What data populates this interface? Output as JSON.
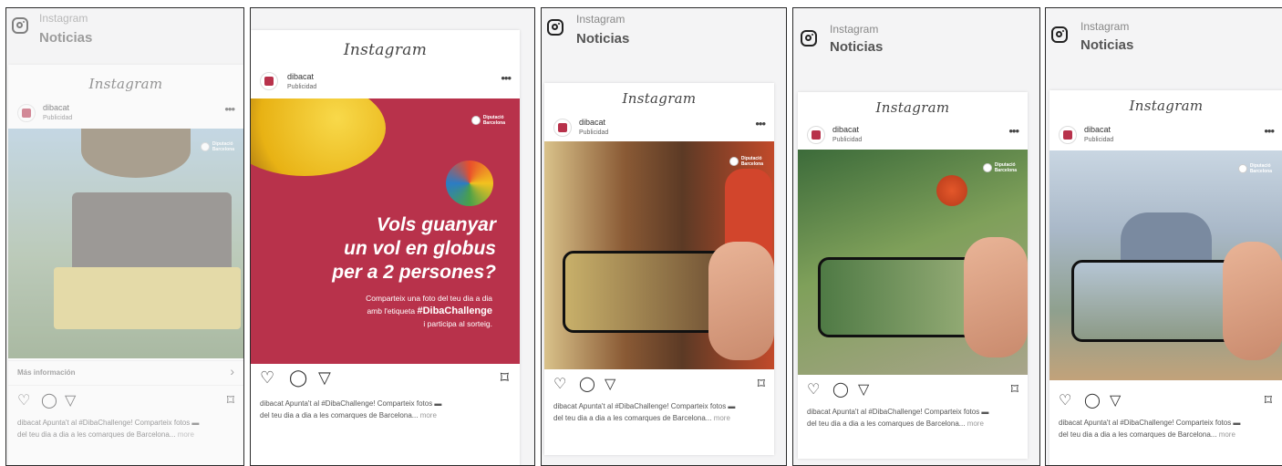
{
  "app": {
    "name": "Instagram",
    "section": "Noticias",
    "wordmark": "Instagram"
  },
  "post": {
    "account": "dibacat",
    "sponsored": "Publicidad",
    "options": "•••",
    "more_info": "Más información",
    "more_info_chevron": "›",
    "caption_line1": "dibacat Apunta't al #DibaChallenge! Comparteix fotos ▬",
    "caption_line2": "del teu dia a dia a les comarques de Barcelona...",
    "caption_more": "more",
    "brand_name_1": "Diputació",
    "brand_name_2": "Barcelona"
  },
  "promo": {
    "headline_1": "Vols guanyar",
    "headline_2": "un vol en globus",
    "headline_3": "per a 2 persones?",
    "body_1": "Comparteix una foto del teu dia a dia",
    "body_2a": "amb l'etiqueta",
    "body_2b": "#DibaChallenge",
    "body_3": "i participa al sorteig."
  },
  "icons": {
    "like": "♡",
    "comment": "◯",
    "share": "▽",
    "save": "⌑"
  },
  "colors": {
    "promo_red": "#b8324b",
    "balloon_yellow": "#f2c21f",
    "frame_border": "#2a2a2a",
    "panel_bg": "#f4f4f5"
  }
}
